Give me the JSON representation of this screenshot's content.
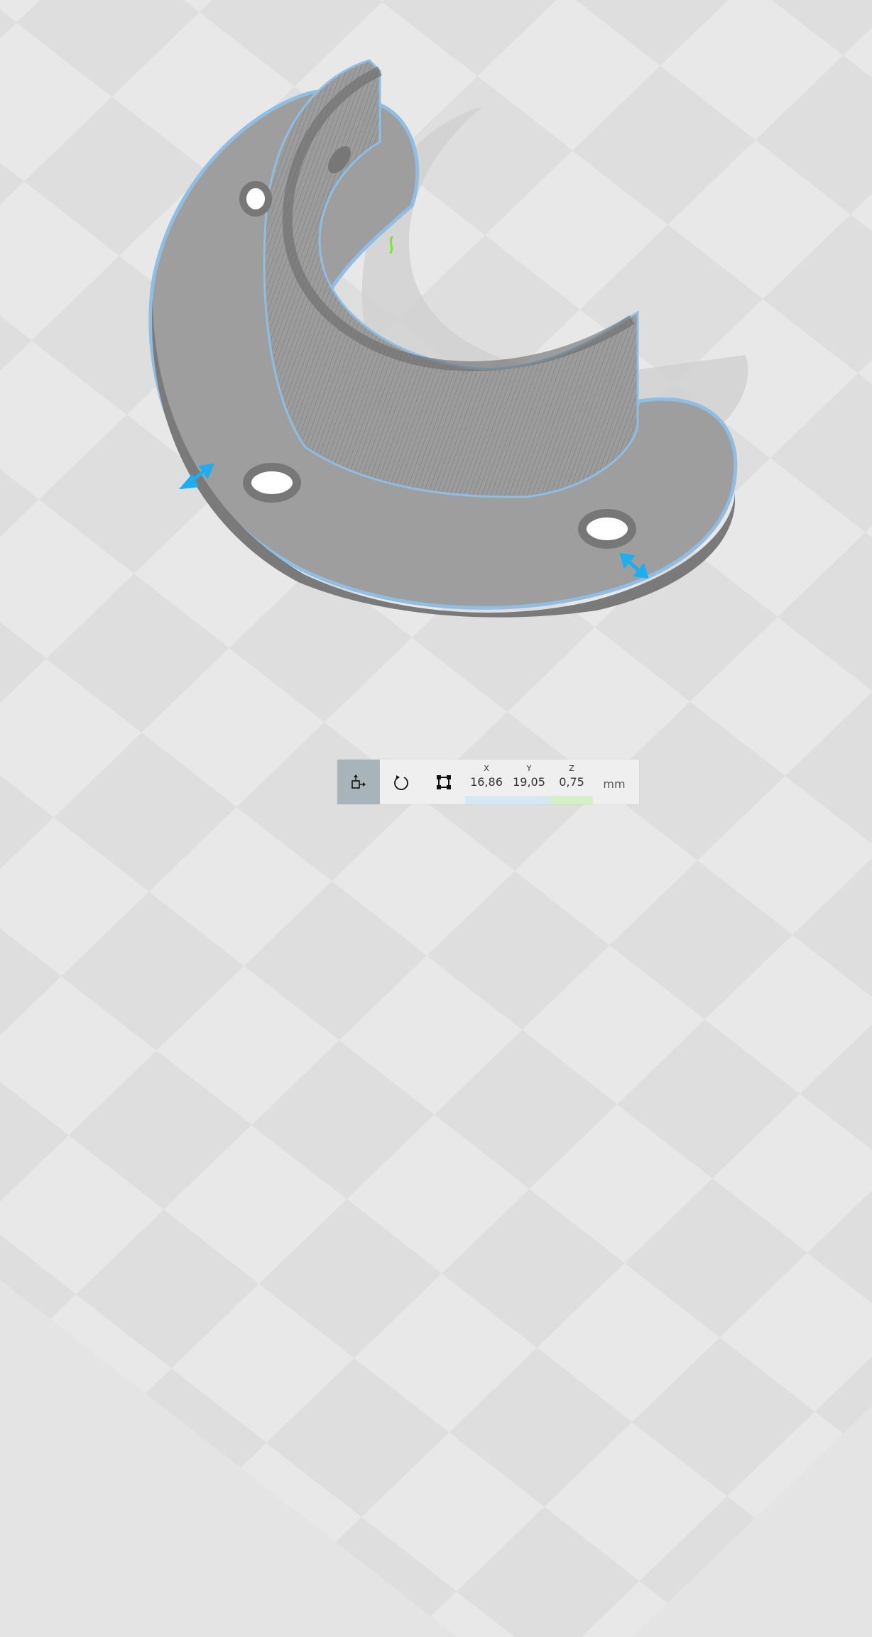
{
  "toolbar": {
    "tools": [
      {
        "name": "move",
        "icon": "move-icon",
        "active": true
      },
      {
        "name": "rotate",
        "icon": "rotate-icon",
        "active": false
      },
      {
        "name": "scale",
        "icon": "scale-icon",
        "active": false
      }
    ],
    "coords": [
      {
        "label": "X",
        "value": "16,86",
        "color": "#d6e8f2"
      },
      {
        "label": "Y",
        "value": "19,05",
        "color": "#d6e8f2"
      },
      {
        "label": "Z",
        "value": "0,75",
        "color": "#d4f0c8"
      }
    ],
    "unit": "mm"
  },
  "colors": {
    "selection": "#8fbde3",
    "handle_blue": "#1eaef0",
    "handle_green": "#7fe03a",
    "model": "#9a9a9a"
  }
}
